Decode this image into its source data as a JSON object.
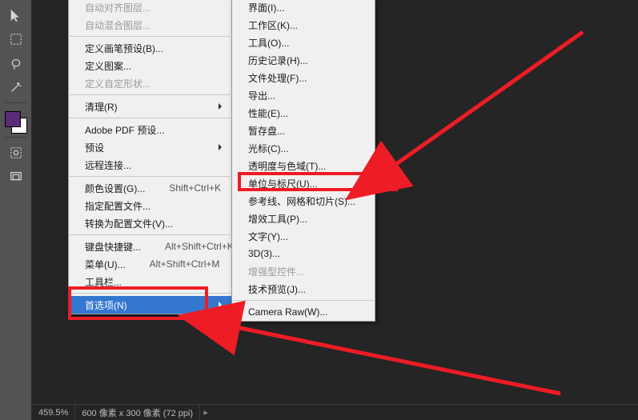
{
  "statusbar": {
    "zoom": "459.5%",
    "docinfo": "600 像素 x 300 像素 (72 ppi)"
  },
  "menu1": {
    "items": [
      {
        "label": "自动对齐图层...",
        "disabled": true
      },
      {
        "label": "自动混合图层...",
        "disabled": true
      },
      {
        "sep": true
      },
      {
        "label": "定义画笔预设(B)..."
      },
      {
        "label": "定义图案..."
      },
      {
        "label": "定义自定形状...",
        "disabled": true
      },
      {
        "sep": true
      },
      {
        "label": "清理(R)",
        "sub": true
      },
      {
        "sep": true
      },
      {
        "label": "Adobe PDF 预设..."
      },
      {
        "label": "预设",
        "sub": true
      },
      {
        "label": "远程连接..."
      },
      {
        "sep": true
      },
      {
        "label": "颜色设置(G)...",
        "shortcut": "Shift+Ctrl+K"
      },
      {
        "label": "指定配置文件..."
      },
      {
        "label": "转换为配置文件(V)..."
      },
      {
        "sep": true
      },
      {
        "label": "键盘快捷键...",
        "shortcut": "Alt+Shift+Ctrl+K"
      },
      {
        "label": "菜单(U)...",
        "shortcut": "Alt+Shift+Ctrl+M"
      },
      {
        "label": "工具栏..."
      },
      {
        "sep": true
      },
      {
        "label": "首选项(N)",
        "sub": true,
        "selected": true
      }
    ]
  },
  "menu2": {
    "items": [
      {
        "label": "界面(I)..."
      },
      {
        "label": "工作区(K)..."
      },
      {
        "label": "工具(O)..."
      },
      {
        "label": "历史记录(H)..."
      },
      {
        "label": "文件处理(F)..."
      },
      {
        "label": "导出..."
      },
      {
        "label": "性能(E)..."
      },
      {
        "label": "暂存盘..."
      },
      {
        "label": "光标(C)..."
      },
      {
        "label": "透明度与色域(T)..."
      },
      {
        "label": "单位与标尺(U)..."
      },
      {
        "label": "参考线、网格和切片(S)..."
      },
      {
        "label": "增效工具(P)..."
      },
      {
        "label": "文字(Y)..."
      },
      {
        "label": "3D(3)..."
      },
      {
        "label": "增强型控件...",
        "disabled": true
      },
      {
        "label": "技术预览(J)..."
      },
      {
        "sep": true
      },
      {
        "label": "Camera Raw(W)..."
      }
    ]
  }
}
